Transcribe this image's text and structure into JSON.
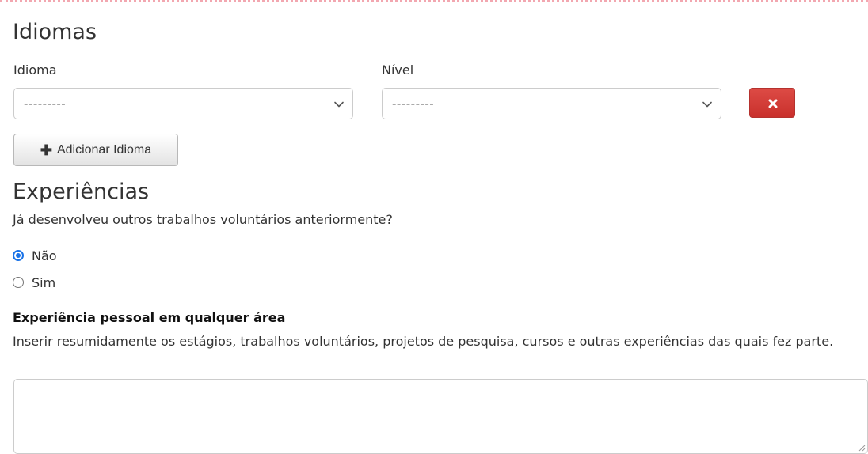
{
  "idiomas": {
    "title": "Idiomas",
    "idioma_label": "Idioma",
    "idioma_selected": "---------",
    "nivel_label": "Nível",
    "nivel_selected": "---------",
    "remove_icon": "close-icon",
    "add_button_label": "Adicionar Idioma",
    "add_button_icon": "plus-icon"
  },
  "experiencias": {
    "title": "Experiências",
    "question": "Já desenvolveu outros trabalhos voluntários anteriormente?",
    "options": [
      {
        "label": "Não",
        "checked": true
      },
      {
        "label": "Sim",
        "checked": false
      }
    ],
    "personal_label": "Experiência pessoal em qualquer área",
    "personal_help": "Inserir resumidamente os estágios, trabalhos voluntários, projetos de pesquisa, cursos e outras experiências das quais fez parte.",
    "personal_value": ""
  },
  "colors": {
    "danger": "#c9302c",
    "radio_accent": "#1a73e8",
    "top_border": "#f2a7b0"
  }
}
